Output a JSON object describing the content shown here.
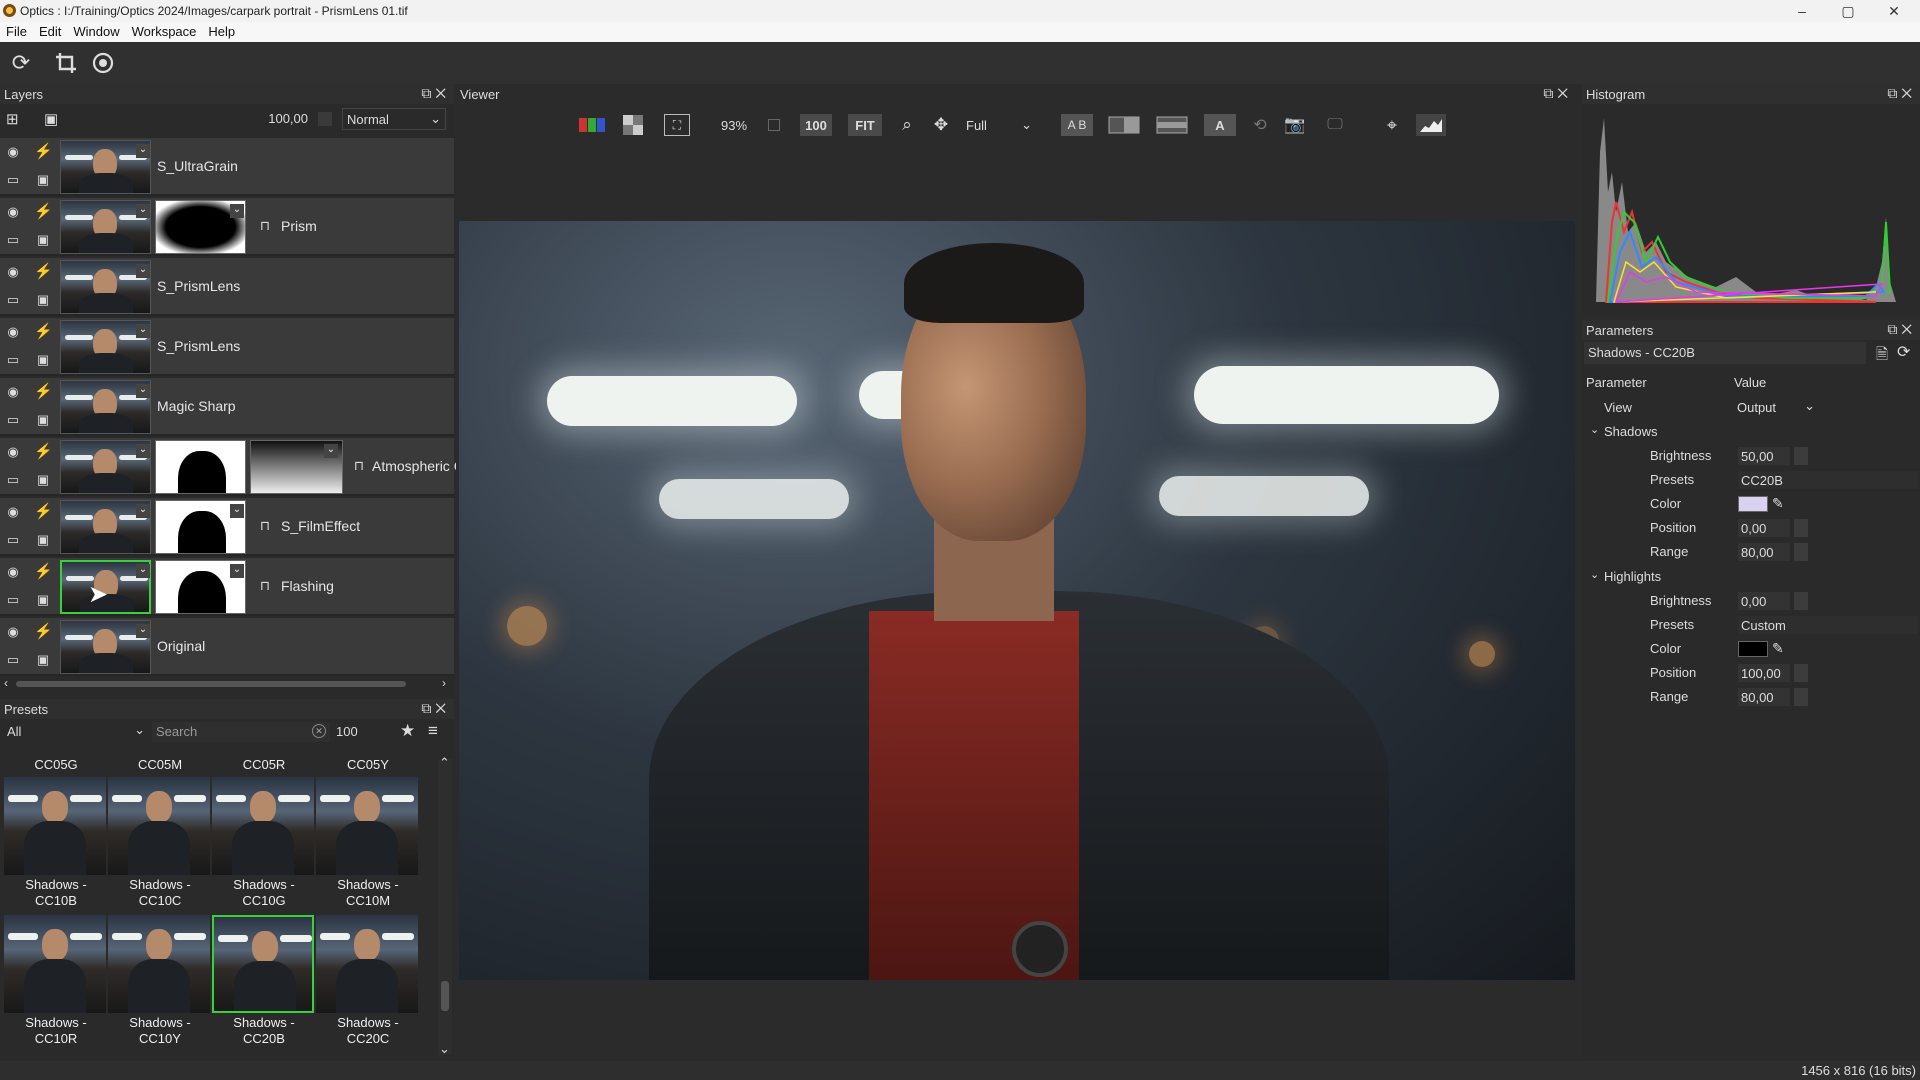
{
  "window": {
    "title": "Optics : I:/Training/Optics 2024/Images/carpark portrait - PrismLens 01.tif",
    "min": "–",
    "max": "▢",
    "close": "✕"
  },
  "menu": [
    "File",
    "Edit",
    "Window",
    "Workspace",
    "Help"
  ],
  "toolbar": {
    "icons": [
      "refresh-icon",
      "crop-icon",
      "target-icon"
    ]
  },
  "layers_panel": {
    "title": "Layers",
    "opacity": "100,00",
    "blend_mode": "Normal",
    "items": [
      {
        "name": "S_UltraGrain",
        "mask": "none"
      },
      {
        "name": "Prism",
        "mask": "vignette"
      },
      {
        "name": "S_PrismLens",
        "mask": "none"
      },
      {
        "name": "S_PrismLens",
        "mask": "none"
      },
      {
        "name": "Magic Sharp",
        "mask": "none"
      },
      {
        "name": "Atmospheric G",
        "mask": "double"
      },
      {
        "name": "S_FilmEffect",
        "mask": "silhouette"
      },
      {
        "name": "Flashing",
        "mask": "silhouette"
      },
      {
        "name": "Original",
        "mask": "none"
      }
    ]
  },
  "presets_panel": {
    "title": "Presets",
    "category": "All",
    "search_placeholder": "Search",
    "count": "100",
    "headers": [
      "CC05G",
      "CC05M",
      "CC05R",
      "CC05Y"
    ],
    "row1": [
      {
        "l1": "Shadows -",
        "l2": "CC10B"
      },
      {
        "l1": "Shadows -",
        "l2": "CC10C"
      },
      {
        "l1": "Shadows -",
        "l2": "CC10G"
      },
      {
        "l1": "Shadows -",
        "l2": "CC10M"
      }
    ],
    "row2": [
      {
        "l1": "Shadows -",
        "l2": "CC10R"
      },
      {
        "l1": "Shadows -",
        "l2": "CC10Y"
      },
      {
        "l1": "Shadows -",
        "l2": "CC20B"
      },
      {
        "l1": "Shadows -",
        "l2": "CC20C"
      }
    ]
  },
  "viewer": {
    "title": "Viewer",
    "zoom": "93%",
    "btn_100": "100",
    "btn_fit": "FIT",
    "quality": "Full",
    "ab": "A B",
    "a_btn": "A"
  },
  "histogram": {
    "title": "Histogram"
  },
  "parameters": {
    "title": "Parameters",
    "preset_name": "Shadows - CC20B",
    "col_param": "Parameter",
    "col_value": "Value",
    "view_label": "View",
    "view_value": "Output",
    "shadows": {
      "label": "Shadows",
      "brightness_label": "Brightness",
      "brightness": "50,00",
      "presets_label": "Presets",
      "presets": "CC20B",
      "color_label": "Color",
      "color": "#d8d2f0",
      "position_label": "Position",
      "position": "0,00",
      "range_label": "Range",
      "range": "80,00"
    },
    "highlights": {
      "label": "Highlights",
      "brightness_label": "Brightness",
      "brightness": "0,00",
      "presets_label": "Presets",
      "presets": "Custom",
      "color_label": "Color",
      "color": "#000000",
      "position_label": "Position",
      "position": "100,00",
      "range_label": "Range",
      "range": "80,00"
    }
  },
  "status": {
    "dims": "1456 x 816 (16 bits)"
  },
  "colors": {
    "accent_green": "#39d13b"
  }
}
